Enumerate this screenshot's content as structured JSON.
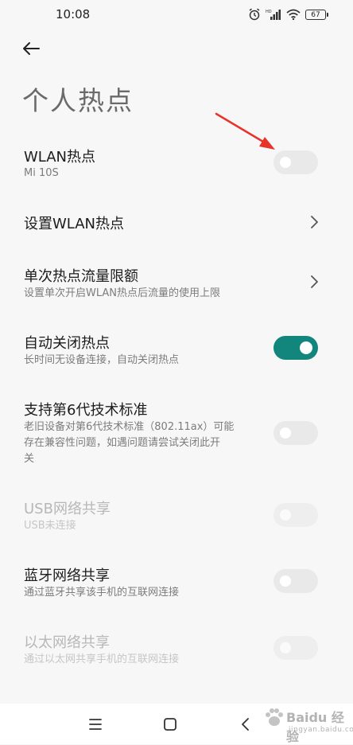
{
  "status_bar": {
    "time": "10:08",
    "battery": "67"
  },
  "page": {
    "title": "个人热点"
  },
  "settings": {
    "wlan_hotspot": {
      "title": "WLAN热点",
      "subtitle": "Mi 10S",
      "enabled": false
    },
    "setup_wlan": {
      "title": "设置WLAN热点"
    },
    "data_limit": {
      "title": "单次热点流量限额",
      "subtitle": "设置单次开启WLAN热点后流量的使用上限"
    },
    "auto_off": {
      "title": "自动关闭热点",
      "subtitle": "长时间无设备连接，自动关闭热点",
      "enabled": true
    },
    "wifi6": {
      "title": "支持第6代技术标准",
      "subtitle_line1": "老旧设备对第6代技术标准（802.11ax）可能",
      "subtitle_line2": "存在兼容性问题，如遇问题请尝试关闭此开",
      "subtitle_line3": "关",
      "enabled": false
    },
    "usb_share": {
      "title": "USB网络共享",
      "subtitle": "USB未连接",
      "enabled": false,
      "disabled": true
    },
    "bt_share": {
      "title": "蓝牙网络共享",
      "subtitle": "通过蓝牙共享该手机的互联网连接",
      "enabled": false
    },
    "eth_share": {
      "title": "以太网络共享",
      "subtitle": "通过以太网共享手机的互联网连接",
      "enabled": false,
      "disabled": true
    }
  },
  "watermark": {
    "text": "Baidu 经验",
    "sub": "jingyan.baidu.com"
  },
  "colors": {
    "accent": "#12867c",
    "annotation": "#e8332a"
  }
}
